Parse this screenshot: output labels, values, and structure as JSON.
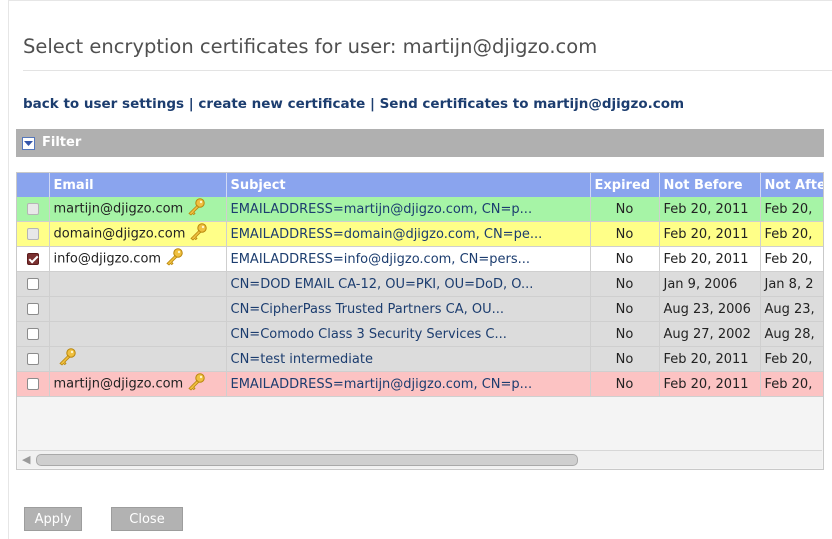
{
  "page": {
    "title": "Select encryption certificates for user: martijn@djigzo.com"
  },
  "links": {
    "back": "back to user settings",
    "create": "create new certificate",
    "send": "Send certificates to martijn@djigzo.com",
    "separator": "|"
  },
  "filter": {
    "label": "Filter"
  },
  "table": {
    "headers": {
      "email": "Email",
      "subject": "Subject",
      "expired": "Expired",
      "not_before": "Not Before",
      "not_after": "Not After"
    },
    "rows": [
      {
        "status": "green",
        "checkbox": "disabled",
        "email": "martijn@djigzo.com",
        "key": true,
        "subject": "EMAILADDRESS=martijn@djigzo.com, CN=p...",
        "expired": "No",
        "not_before": "Feb 20, 2011",
        "not_after": "Feb 20,"
      },
      {
        "status": "yellow",
        "checkbox": "disabled",
        "email": "domain@djigzo.com",
        "key": true,
        "subject": "EMAILADDRESS=domain@djigzo.com, CN=pe...",
        "expired": "No",
        "not_before": "Feb 20, 2011",
        "not_after": "Feb 20,"
      },
      {
        "status": "white",
        "checkbox": "checked",
        "email": "info@djigzo.com",
        "key": true,
        "subject": "EMAILADDRESS=info@djigzo.com, CN=pers...",
        "expired": "No",
        "not_before": "Feb 20, 2011",
        "not_after": "Feb 20,"
      },
      {
        "status": "gray",
        "checkbox": "unchecked",
        "email": "",
        "key": false,
        "subject": "CN=DOD EMAIL CA-12, OU=PKI, OU=DoD, O...",
        "expired": "No",
        "not_before": "Jan 9, 2006",
        "not_after": "Jan 8, 2"
      },
      {
        "status": "gray",
        "checkbox": "unchecked",
        "email": "",
        "key": false,
        "subject": "CN=CipherPass Trusted Partners CA, OU...",
        "expired": "No",
        "not_before": "Aug 23, 2006",
        "not_after": "Aug 23,"
      },
      {
        "status": "gray",
        "checkbox": "unchecked",
        "email": "",
        "key": false,
        "subject": "CN=Comodo Class 3 Security Services C...",
        "expired": "No",
        "not_before": "Aug 27, 2002",
        "not_after": "Aug 28,"
      },
      {
        "status": "gray",
        "checkbox": "unchecked",
        "email": "",
        "key": true,
        "subject": "CN=test intermediate",
        "expired": "No",
        "not_before": "Feb 20, 2011",
        "not_after": "Feb 20,"
      },
      {
        "status": "pink",
        "checkbox": "unchecked",
        "email": "martijn@djigzo.com",
        "key": true,
        "subject": "EMAILADDRESS=martijn@djigzo.com, CN=p...",
        "expired": "No",
        "not_before": "Feb 20, 2011",
        "not_after": "Feb 20,"
      }
    ]
  },
  "buttons": {
    "apply": "Apply",
    "close": "Close"
  },
  "icons": {
    "key": "key-icon",
    "filter_toggle": "chevron-down-icon",
    "scroll_left": "chevron-left-icon"
  },
  "colors": {
    "header_bg": "#8aa4ee",
    "filter_bg": "#b0b0b0",
    "row_green": "#a6f4a6",
    "row_yellow": "#ffff88",
    "row_white": "#ffffff",
    "row_gray": "#dcdcdc",
    "row_pink": "#fcc3c3",
    "link": "#1c3d6f",
    "button_bg": "#b2b2b2"
  }
}
